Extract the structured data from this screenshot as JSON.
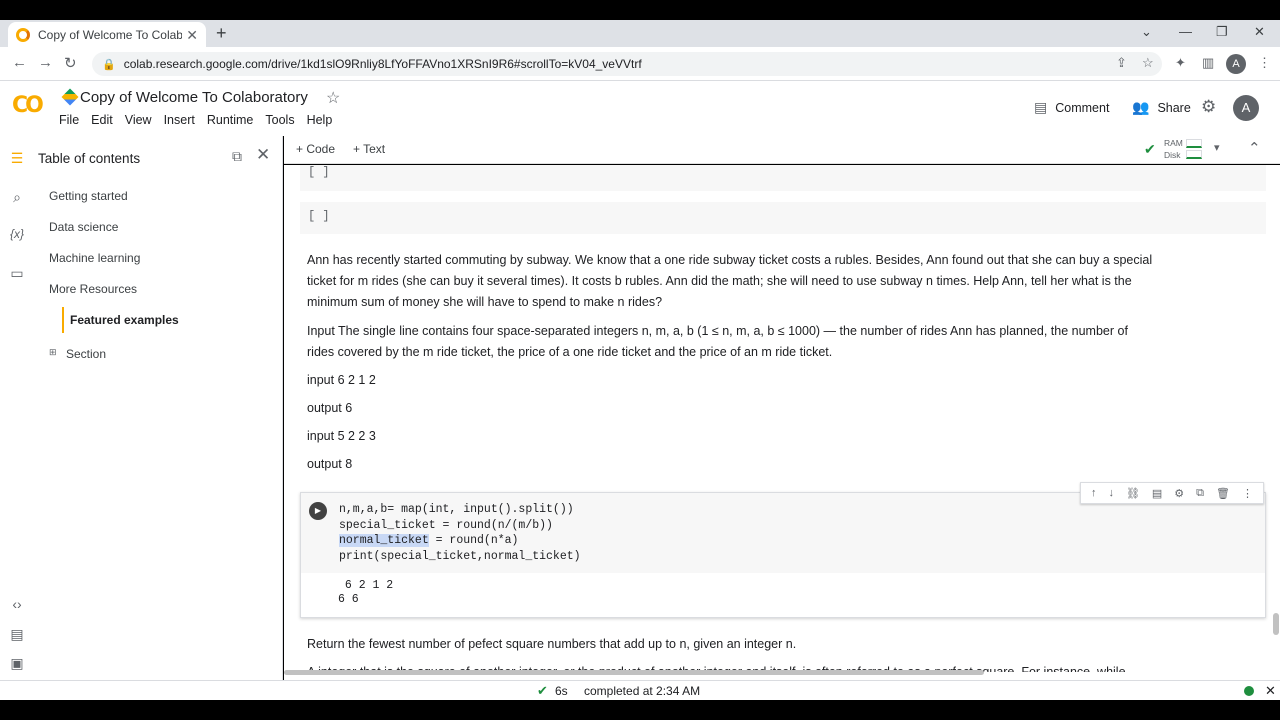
{
  "browser": {
    "tab_title": "Copy of Welcome To Colaborato",
    "tab_close": "✕",
    "new_tab": "+",
    "url": "colab.research.google.com/drive/1kd1slO9Rnliy8LfYoFFAVno1XRSnI9R6#scrollTo=kV04_veVVtrf",
    "profile_initial": "A"
  },
  "colab": {
    "logo": "CO",
    "notebook_title": "Copy of Welcome To Colaboratory",
    "menu": [
      "File",
      "Edit",
      "View",
      "Insert",
      "Runtime",
      "Tools",
      "Help"
    ],
    "comment_label": "Comment",
    "share_label": "Share",
    "avatar_initial": "A"
  },
  "toc": {
    "title": "Table of contents",
    "items": [
      "Getting started",
      "Data science",
      "Machine learning",
      "More Resources",
      "Featured examples",
      "Section"
    ]
  },
  "nb_toolbar": {
    "code_label": "+ Code",
    "text_label": "+ Text",
    "ram_label": "RAM",
    "disk_label": "Disk"
  },
  "cells": {
    "empty_marker": "[ ]",
    "problem1": "Ann has recently started commuting by subway. We know that a one ride subway ticket costs a rubles. Besides, Ann found out that she can buy a special ticket for m rides (she can buy it several times). It costs b rubles. Ann did the math; she will need to use subway n times. Help Ann, tell her what is the minimum sum of money she will have to spend to make n rides?",
    "problem1_input": "Input The single line contains four space-separated integers n, m, a, b (1 ≤ n, m, a, b ≤ 1000) — the number of rides Ann has planned, the number of rides covered by the m ride ticket, the price of a one ride ticket and the price of an m ride ticket.",
    "examples": [
      "input 6 2 1 2",
      "output 6",
      "input 5 2 2 3",
      "output 8"
    ],
    "code_lines": [
      "n,m,a,b= map(int, input().split())",
      "special_ticket = round(n/(m/b))",
      "normal_ticket = round(n*a)",
      "print(special_ticket,normal_ticket)"
    ],
    "output_lines": [
      " 6 2 1 2",
      "6 6"
    ],
    "problem2": "Return the fewest number of pefect square numbers that add up to n, given an integer n.",
    "problem2_cut": "A integer that is the square of another integer, or the product of another integer and itself, is often referred to as a perfect square. For instance, while"
  },
  "status": {
    "duration": "6s",
    "message": "completed at 2:34 AM"
  },
  "colors": {
    "accent": "#f9ab00",
    "ok": "#1e8e3e"
  }
}
